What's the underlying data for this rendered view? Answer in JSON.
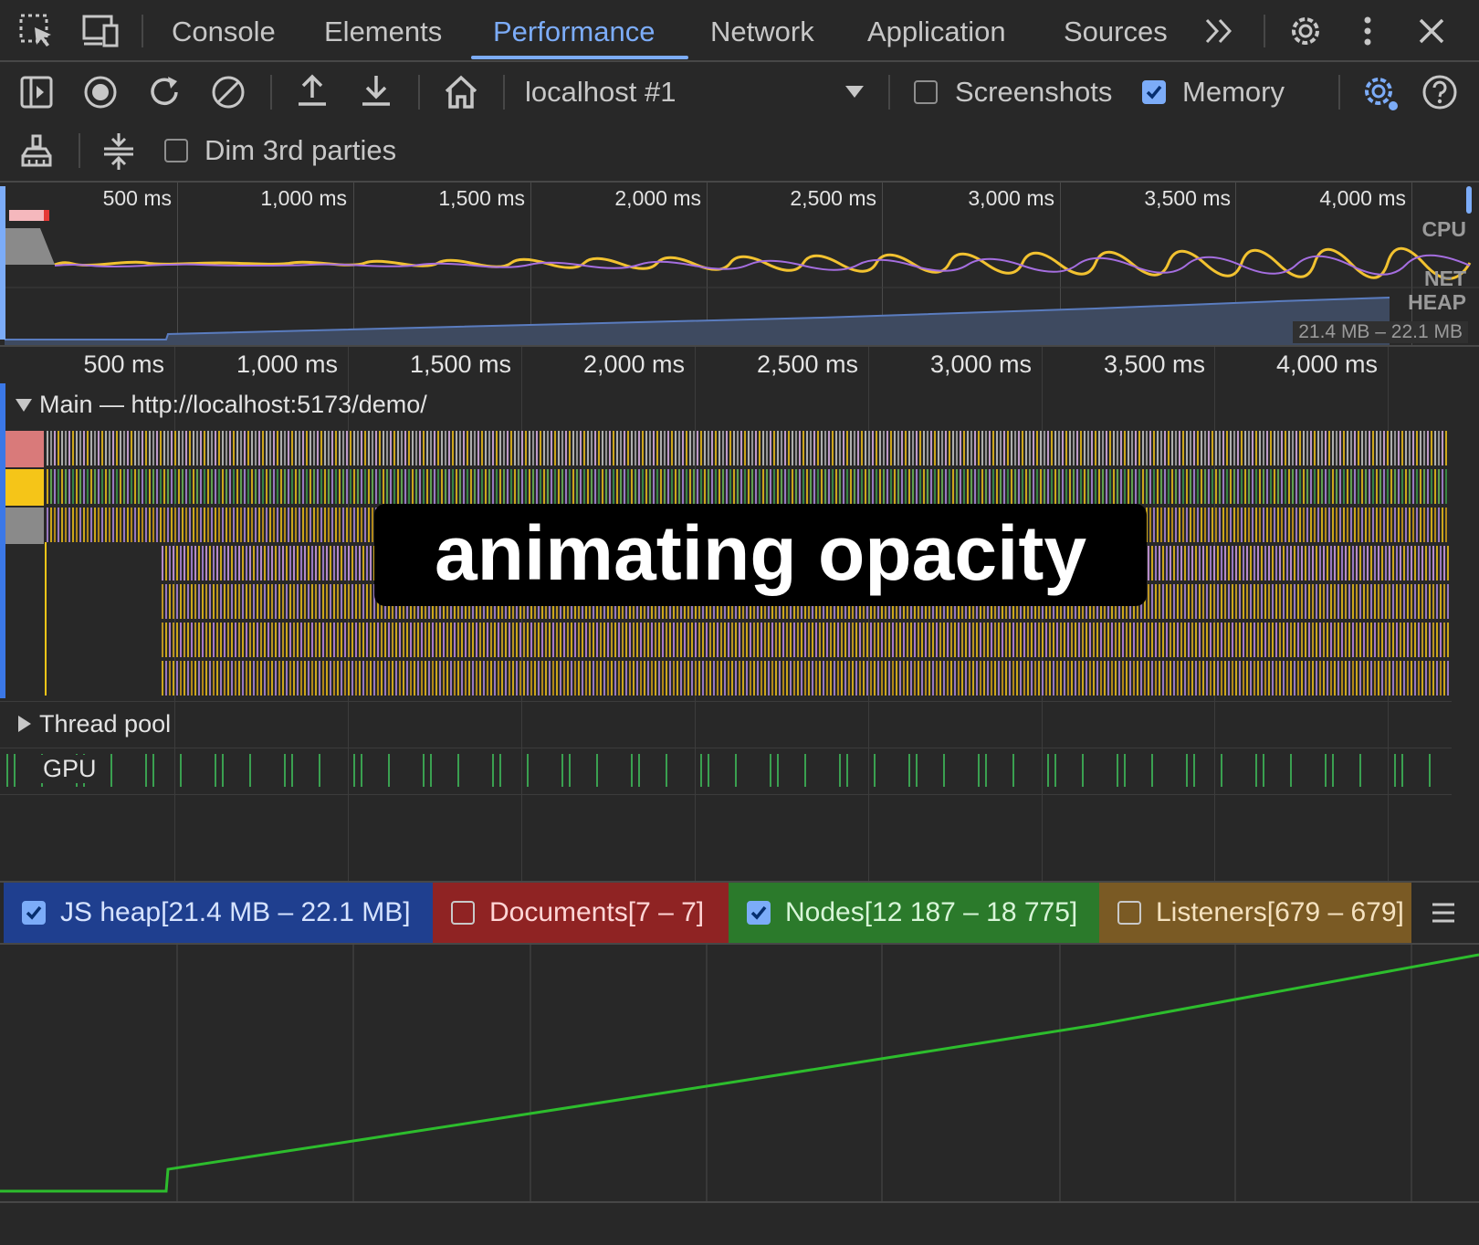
{
  "tabs": {
    "console": "Console",
    "elements": "Elements",
    "performance": "Performance",
    "network": "Network",
    "application": "Application",
    "sources": "Sources"
  },
  "toolbar": {
    "target": "localhost #1",
    "screenshots_label": "Screenshots",
    "screenshots_checked": false,
    "memory_label": "Memory",
    "memory_checked": true,
    "dim_label": "Dim 3rd parties",
    "dim_checked": false
  },
  "overview": {
    "ticks": [
      "500 ms",
      "1,000 ms",
      "1,500 ms",
      "2,000 ms",
      "2,500 ms",
      "3,000 ms",
      "3,500 ms",
      "4,000 ms"
    ],
    "cpu_label": "CPU",
    "net_label": "NET",
    "heap_label": "HEAP",
    "heap_range": "21.4 MB – 22.1 MB"
  },
  "timeline": {
    "ticks": [
      "500 ms",
      "1,000 ms",
      "1,500 ms",
      "2,000 ms",
      "2,500 ms",
      "3,000 ms",
      "3,500 ms",
      "4,000 ms"
    ],
    "main_title": "Main — http://localhost:5173/demo/",
    "thread_pool": "Thread pool",
    "gpu": "GPU"
  },
  "overlay_text": "animating opacity",
  "counters": {
    "js_heap": "JS heap[21.4 MB – 22.1 MB]",
    "js_heap_checked": true,
    "documents": "Documents[7 – 7]",
    "documents_checked": false,
    "nodes": "Nodes[12 187 – 18 775]",
    "nodes_checked": true,
    "listeners": "Listeners[679 – 679]",
    "listeners_checked": false
  },
  "colors": {
    "accent": "#7cacf8",
    "js_heap_bg": "#1f3f8f",
    "documents_bg": "#8f2323",
    "nodes_bg": "#2b7a2b",
    "listeners_bg": "#7a5a24",
    "nodes_line": "#2dbd2d"
  }
}
